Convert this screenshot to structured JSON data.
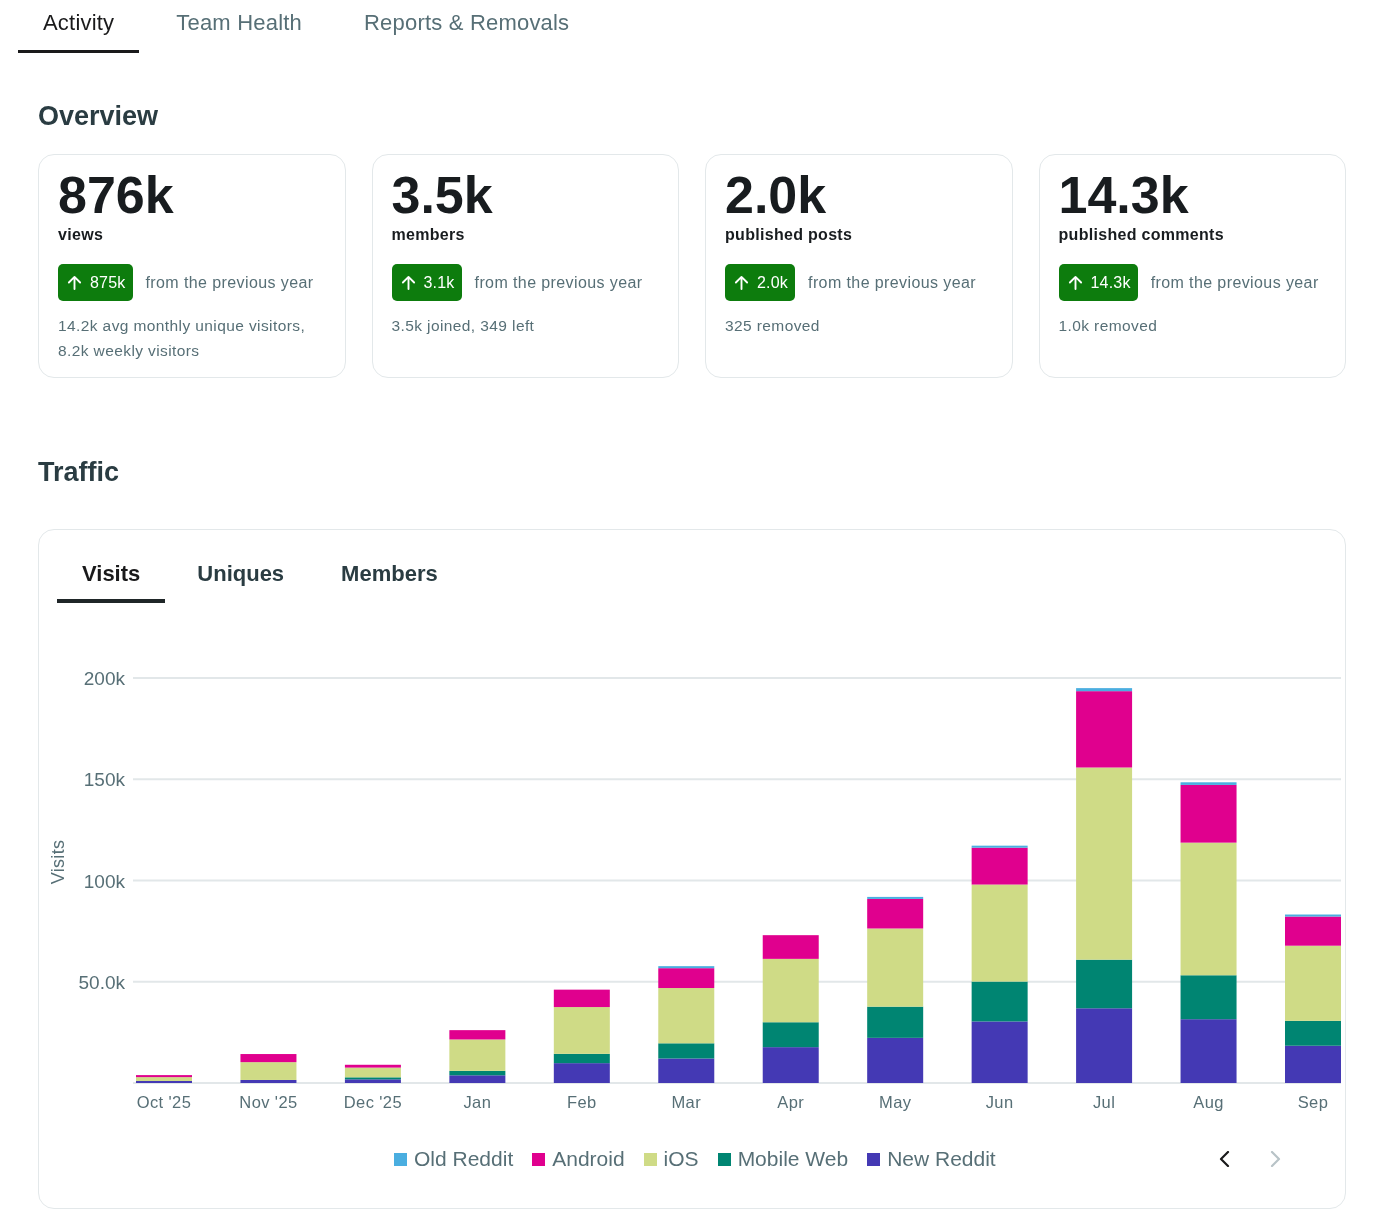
{
  "tabs": [
    {
      "label": "Activity",
      "selected": true
    },
    {
      "label": "Team Health",
      "selected": false
    },
    {
      "label": "Reports & Removals",
      "selected": false
    }
  ],
  "overview": {
    "title": "Overview",
    "cards": [
      {
        "value": "876k",
        "label": "views",
        "change": "875k",
        "change_note": "from the previous year",
        "detail": "14.2k avg monthly unique visitors, 8.2k weekly visitors"
      },
      {
        "value": "3.5k",
        "label": "members",
        "change": "3.1k",
        "change_note": "from the previous year",
        "detail": "3.5k joined, 349 left"
      },
      {
        "value": "2.0k",
        "label": "published posts",
        "change": "2.0k",
        "change_note": "from the previous year",
        "detail": "325 removed"
      },
      {
        "value": "14.3k",
        "label": "published comments",
        "change": "14.3k",
        "change_note": "from the previous year",
        "detail": "1.0k removed"
      }
    ]
  },
  "traffic": {
    "title": "Traffic",
    "tabs": [
      {
        "label": "Visits",
        "selected": true
      },
      {
        "label": "Uniques",
        "selected": false
      },
      {
        "label": "Members",
        "selected": false
      }
    ],
    "chart_data": {
      "type": "bar",
      "stacked": true,
      "grid": true,
      "ylabel": "Visits",
      "categories": [
        "Oct '25",
        "Nov '25",
        "Dec '25",
        "Jan",
        "Feb",
        "Mar",
        "Apr",
        "May",
        "Jun",
        "Jul",
        "Aug",
        "Sep"
      ],
      "series": [
        {
          "name": "Old Reddit",
          "color": "#4aaee0",
          "values": [
            null,
            null,
            null,
            null,
            null,
            1000,
            null,
            1000,
            1000,
            1500,
            1300,
            1000
          ]
        },
        {
          "name": "Android",
          "color": "#e0008e",
          "values": [
            1000,
            4000,
            1400,
            4600,
            8600,
            9800,
            11700,
            14600,
            18200,
            37700,
            28500,
            14400
          ]
        },
        {
          "name": "iOS",
          "color": "#cfdb86",
          "values": [
            1900,
            8800,
            4800,
            15500,
            23100,
            27300,
            31300,
            38600,
            47900,
            94900,
            65500,
            37100
          ]
        },
        {
          "name": "Mobile Web",
          "color": "#008572",
          "values": [
            null,
            null,
            1000,
            2200,
            4600,
            7500,
            12300,
            15400,
            19700,
            24000,
            21700,
            12300
          ]
        },
        {
          "name": "New Reddit",
          "color": "#4439b4",
          "values": [
            1000,
            1500,
            1800,
            3800,
            9800,
            12100,
            17700,
            22300,
            30400,
            36900,
            31500,
            18400
          ]
        }
      ],
      "ylim": [
        0,
        200000
      ],
      "yticks": [
        {
          "value": 50000,
          "label": "50.0k"
        },
        {
          "value": 100000,
          "label": "100k"
        },
        {
          "value": 150000,
          "label": "150k"
        },
        {
          "value": 200000,
          "label": "200k"
        }
      ]
    },
    "pager": [
      {
        "kind": "previous",
        "disabled": false
      },
      {
        "kind": "next",
        "disabled": true
      }
    ]
  }
}
